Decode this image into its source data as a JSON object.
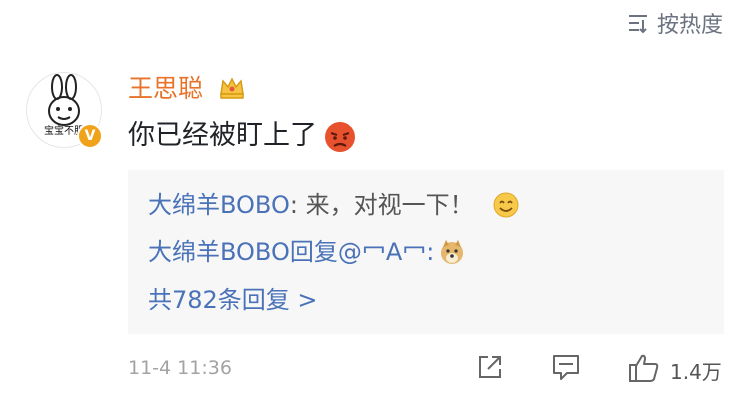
{
  "sort": {
    "label": "按热度",
    "icon": "sort-icon"
  },
  "comment": {
    "avatar_text": "宝宝不服",
    "verified_icon": "verified-badge-icon",
    "username": "王思聪",
    "crown_icon": "crown-icon",
    "text": "你已经被盯上了",
    "emoji_icon": "angry-face-emoji"
  },
  "replies": {
    "line1_author": "大绵羊BOBO",
    "line1_text": ": 来，对视一下！",
    "line1_emoji": "smile-emoji",
    "line2_author": "大绵羊BOBO",
    "line2_text": "回复@冖A冖:",
    "line2_emoji": "doge-emoji",
    "total": "共782条回复 >"
  },
  "footer": {
    "time": "11-4 11:36",
    "share_icon": "share-icon",
    "reply_icon": "comment-icon",
    "like_icon": "thumbs-up-icon",
    "like_count": "1.4万"
  },
  "colors": {
    "username": "#e8732a",
    "link_blue": "#4a72b8",
    "reply_bg": "#f7f7f7",
    "meta": "#a3a3a3"
  }
}
